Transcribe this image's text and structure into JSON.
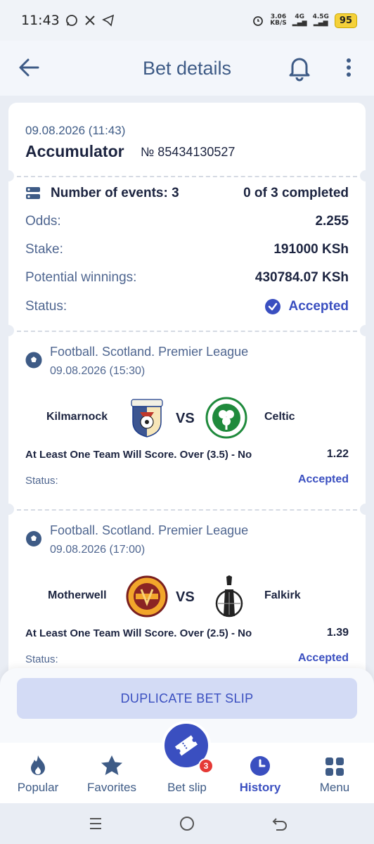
{
  "status_bar": {
    "time": "11:43",
    "speed_value": "3.06",
    "speed_unit": "KB/S",
    "net1": "4G",
    "net2": "4.5G",
    "battery": "95"
  },
  "header": {
    "title": "Bet details"
  },
  "bet": {
    "date": "09.08.2026 (11:43)",
    "type": "Accumulator",
    "number": "№ 85434130527",
    "events_label": "Number of events: 3",
    "completed": "0 of 3 completed",
    "odds_label": "Odds:",
    "odds_value": "2.255",
    "stake_label": "Stake:",
    "stake_value": "191000 KSh",
    "winnings_label": "Potential winnings:",
    "winnings_value": "430784.07 KSh",
    "status_label": "Status:",
    "status_value": "Accepted"
  },
  "events": [
    {
      "league": "Football. Scotland. Premier League",
      "datetime": "09.08.2026 (15:30)",
      "home": "Kilmarnock",
      "away": "Celtic",
      "vs": "VS",
      "market": "At Least One Team Will Score. Over (3.5) - No",
      "odds": "1.22",
      "status_label": "Status:",
      "status_value": "Accepted"
    },
    {
      "league": "Football. Scotland. Premier League",
      "datetime": "09.08.2026 (17:00)",
      "home": "Motherwell",
      "away": "Falkirk",
      "vs": "VS",
      "market": "At Least One Team Will Score. Over (2.5) - No",
      "odds": "1.39",
      "status_label": "Status:",
      "status_value": "Accepted"
    }
  ],
  "actions": {
    "duplicate": "DUPLICATE BET SLIP"
  },
  "nav": {
    "popular": "Popular",
    "favorites": "Favorites",
    "betslip": "Bet slip",
    "betslip_count": "3",
    "history": "History",
    "menu": "Menu"
  },
  "colors": {
    "accent": "#3a4fc0",
    "title": "#3e5b86",
    "background": "#e9edf4"
  }
}
